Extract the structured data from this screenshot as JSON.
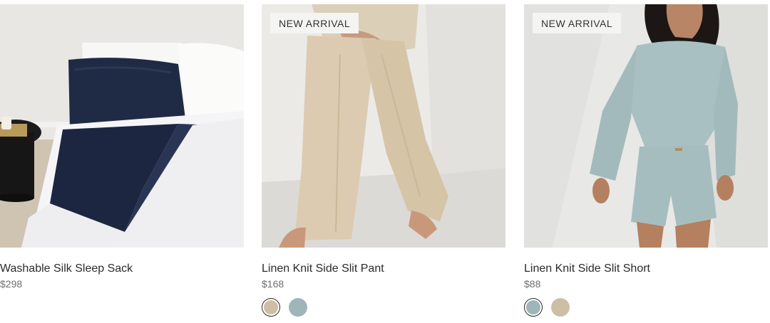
{
  "products": [
    {
      "title": "Washable Silk Sleep Sack",
      "price": "$298",
      "badge": "",
      "image": "bedding-photo"
    },
    {
      "title": "Linen Knit Side Slit Pant",
      "price": "$168",
      "badge": "NEW ARRIVAL",
      "image": "pant-photo",
      "swatches": [
        {
          "color": "#cdbfa6",
          "selected": true
        },
        {
          "color": "#9fb6b8",
          "selected": false
        }
      ]
    },
    {
      "title": "Linen Knit Side Slit Short",
      "price": "$88",
      "badge": "NEW ARRIVAL",
      "image": "short-photo",
      "swatches": [
        {
          "color": "#9fb6b8",
          "selected": true
        },
        {
          "color": "#cdbfa6",
          "selected": false
        }
      ]
    }
  ]
}
